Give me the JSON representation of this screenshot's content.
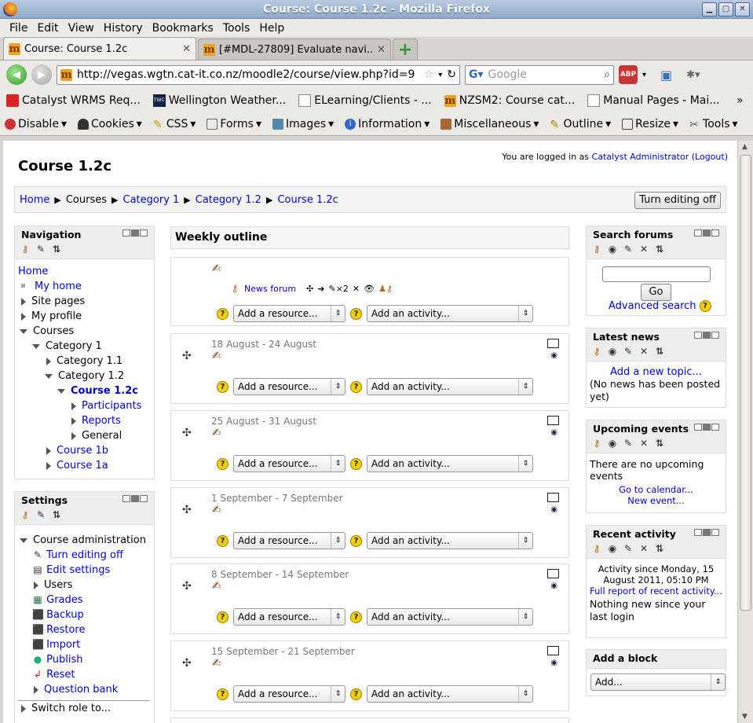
{
  "window": {
    "title": "Course: Course 1.2c - Mozilla Firefox"
  },
  "menu": [
    "File",
    "Edit",
    "View",
    "History",
    "Bookmarks",
    "Tools",
    "Help"
  ],
  "tabs": [
    {
      "label": "Course: Course 1.2c"
    },
    {
      "label": "[#MDL-27809] Evaluate navi..."
    }
  ],
  "toolbar": {
    "url": "http://vegas.wgtn.cat-it.co.nz/moodle2/course/view.php?id=9",
    "search_placeholder": "Google"
  },
  "bookmarks": [
    "Catalyst WRMS Req...",
    "Wellington Weather...",
    "ELearning/Clients - ...",
    "NZSM2: Course cat...",
    "Manual Pages - Mai..."
  ],
  "webdev": [
    "Disable",
    "Cookies",
    "CSS",
    "Forms",
    "Images",
    "Information",
    "Miscellaneous",
    "Outline",
    "Resize",
    "Tools"
  ],
  "page": {
    "course_title": "Course 1.2c",
    "login_prefix": "You are logged in as",
    "login_user": "Catalyst Administrator",
    "logout": "(Logout)",
    "breadcrumb": [
      "Home",
      "Courses",
      "Category 1",
      "Category 1.2",
      "Course 1.2c"
    ],
    "edit_button": "Turn editing off"
  },
  "navigation": {
    "title": "Navigation",
    "items": [
      "Home",
      "My home",
      "Site pages",
      "My profile",
      "Courses",
      "Category 1",
      "Category 1.1",
      "Category 1.2",
      "Course 1.2c",
      "Participants",
      "Reports",
      "General",
      "Course 1b",
      "Course 1a"
    ]
  },
  "settings": {
    "title": "Settings",
    "items": [
      "Course administration",
      "Turn editing off",
      "Edit settings",
      "Users",
      "Grades",
      "Backup",
      "Restore",
      "Import",
      "Publish",
      "Reset",
      "Question bank",
      "Switch role to..."
    ]
  },
  "weekly": {
    "title": "Weekly outline",
    "news_forum": "News forum",
    "add_resource": "Add a resource...",
    "add_activity": "Add an activity...",
    "sections": [
      "18 August - 24 August",
      "25 August - 31 August",
      "1 September - 7 September",
      "8 September - 14 September",
      "15 September - 21 September"
    ]
  },
  "search_forums": {
    "title": "Search forums",
    "go": "Go",
    "advanced": "Advanced search"
  },
  "latest_news": {
    "title": "Latest news",
    "add": "Add a new topic...",
    "empty": "(No news has been posted yet)"
  },
  "upcoming": {
    "title": "Upcoming events",
    "empty": "There are no upcoming events",
    "calendar": "Go to calendar...",
    "new_event": "New event..."
  },
  "recent": {
    "title": "Recent activity",
    "since": "Activity since Monday, 15 August 2011, 05:10 PM",
    "full": "Full report of recent activity...",
    "nothing": "Nothing new since your last login"
  },
  "add_block": {
    "title": "Add a block",
    "select": "Add..."
  }
}
